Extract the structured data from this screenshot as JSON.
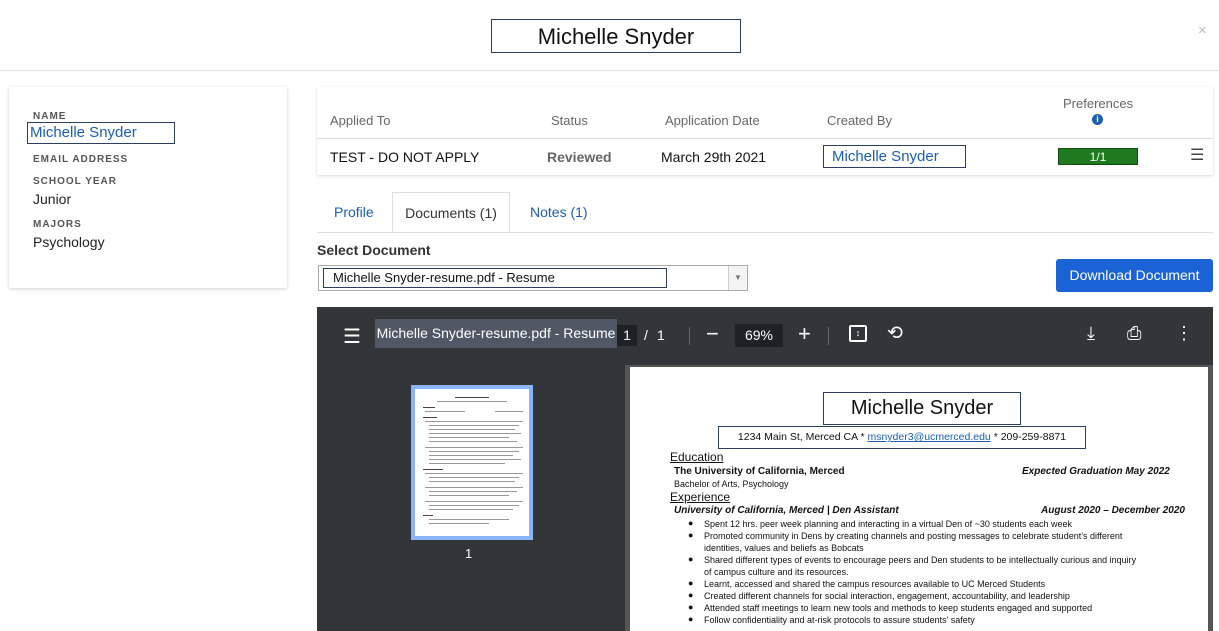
{
  "header": {
    "title": "Michelle Snyder",
    "close_icon": "×"
  },
  "sidebar": {
    "name_label": "NAME",
    "name_value": "Michelle Snyder",
    "email_label": "EMAIL ADDRESS",
    "school_year_label": "SCHOOL YEAR",
    "school_year_value": "Junior",
    "majors_label": "MAJORS",
    "majors_value": "Psychology"
  },
  "application_table": {
    "headers": {
      "applied_to": "Applied To",
      "status": "Status",
      "application_date": "Application Date",
      "created_by": "Created By",
      "preferences": "Preferences"
    },
    "row": {
      "applied_to": "TEST - DO NOT APPLY",
      "status": "Reviewed",
      "application_date": "March 29th 2021",
      "created_by": "Michelle Snyder",
      "preferences": "1/1"
    }
  },
  "tabs": [
    {
      "label": "Profile"
    },
    {
      "label": "Documents (1)",
      "active": true
    },
    {
      "label": "Notes (1)"
    }
  ],
  "document_select": {
    "label": "Select Document",
    "selected": "Michelle Snyder-resume.pdf - Resume"
  },
  "download_button": "Download Document",
  "viewer": {
    "title": "Michelle Snyder-resume.pdf - Resume",
    "current_page": "1",
    "page_separator": "/",
    "total_pages": "1",
    "zoom": "69%",
    "thumbnail_number": "1"
  },
  "resume": {
    "name": "Michelle Snyder",
    "contact_prefix": "1234 Main St, Merced CA * ",
    "email": "msnyder3@ucmerced.edu",
    "contact_suffix": " * 209-259-8871",
    "education_heading": "Education",
    "school": "The University of California, Merced",
    "graduation": "Expected Graduation May 2022",
    "degree": "Bachelor of Arts, Psychology",
    "experience_heading": "Experience",
    "job_title": "University of California, Merced | Den Assistant",
    "job_dates": "August 2020 – December 2020",
    "bullets": [
      "Spent 12 hrs. peer week planning and interacting in a virtual Den of ~30 students each week",
      "Promoted community in Dens by creating channels and posting messages to celebrate student’s different identities, values and beliefs as Bobcats",
      "Shared different types of events to encourage peers and Den students to be intellectually curious and inquiry of campus culture and its resources.",
      "Learnt, accessed and shared the campus resources available to UC Merced Students",
      "Created different channels for social interaction, engagement, accountability, and leadership",
      "Attended staff meetings to learn new tools and methods to keep students engaged and supported",
      "Follow confidentiality and at-risk protocols to assure students’ safety"
    ]
  },
  "colors": {
    "accent": "#1a63d6",
    "link": "#1a5fb4",
    "preference_badge": "#1f7a1f",
    "viewer_toolbar": "#323639"
  }
}
